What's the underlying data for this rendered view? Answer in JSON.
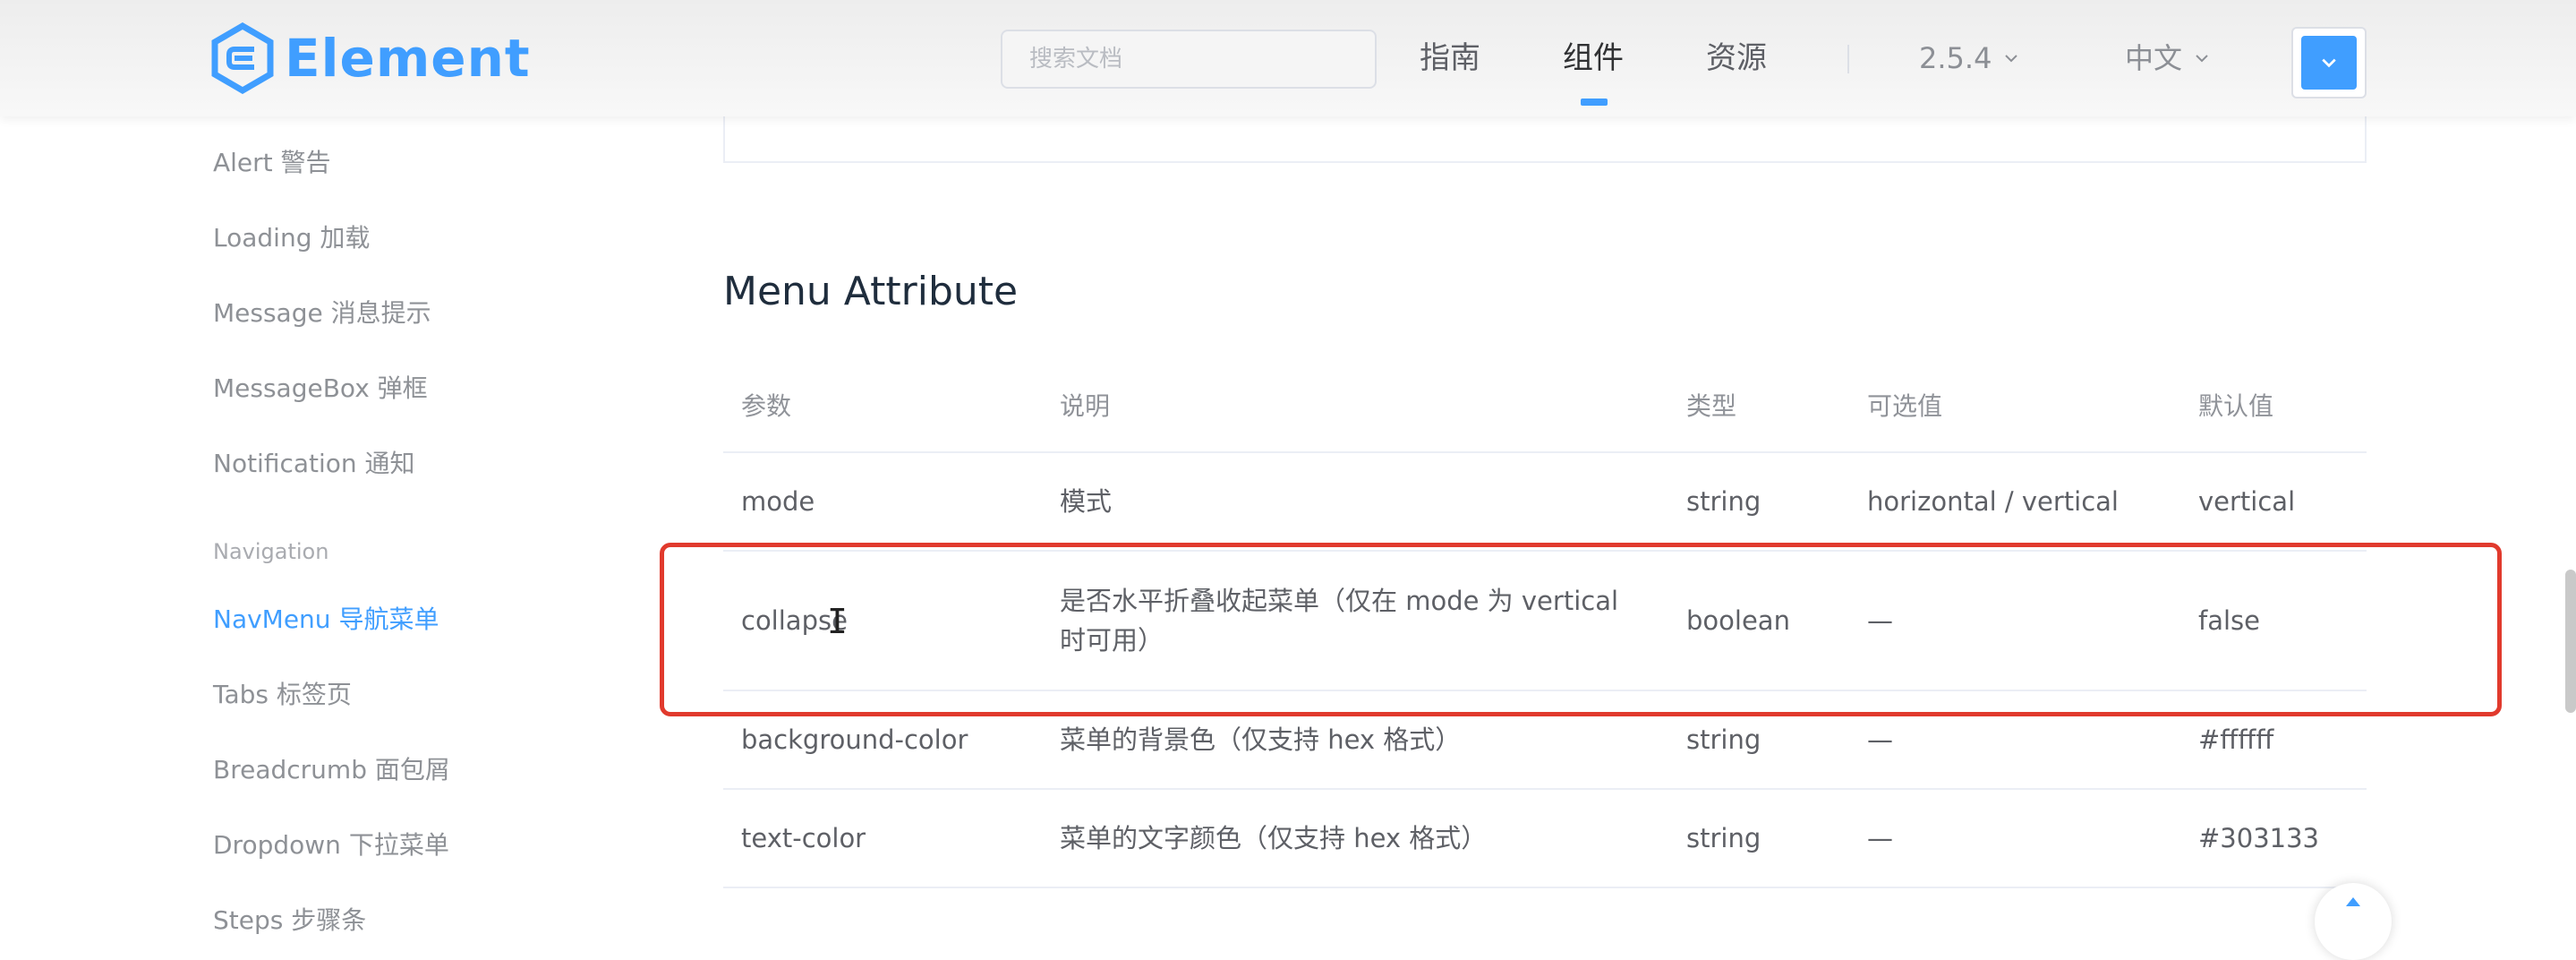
{
  "header": {
    "logo_text": "Element",
    "search_placeholder": "搜索文档",
    "nav": [
      "指南",
      "组件",
      "资源"
    ],
    "active_nav": "组件",
    "version": "2.5.4",
    "language": "中文",
    "accent_color": "#409eff"
  },
  "sidebar": {
    "items_top": [
      "Alert 警告",
      "Loading 加载",
      "Message 消息提示",
      "MessageBox 弹框",
      "Notification 通知"
    ],
    "group_label": "Navigation",
    "items_nav": [
      "NavMenu 导航菜单",
      "Tabs 标签页",
      "Breadcrumb 面包屑",
      "Dropdown 下拉菜单",
      "Steps 步骤条"
    ],
    "active_item": "NavMenu 导航菜单"
  },
  "main": {
    "section_title": "Menu Attribute",
    "table": {
      "headers": [
        "参数",
        "说明",
        "类型",
        "可选值",
        "默认值"
      ],
      "rows": [
        [
          "mode",
          "模式",
          "string",
          "horizontal / vertical",
          "vertical"
        ],
        [
          "collapse",
          "是否水平折叠收起菜单（仅在 mode 为 vertical 时可用）",
          "boolean",
          "—",
          "false"
        ],
        [
          "background-color",
          "菜单的背景色（仅支持 hex 格式）",
          "string",
          "—",
          "#ffffff"
        ],
        [
          "text-color",
          "菜单的文字颜色（仅支持 hex 格式）",
          "string",
          "—",
          "#303133"
        ]
      ],
      "highlighted_row": "collapse",
      "highlight_color": "#e13a2d"
    }
  },
  "icons": {
    "logo": "element-logo-icon",
    "chevron": "chevron-down-icon",
    "cursor": "text-cursor-icon",
    "back_to_top": "caret-up-icon"
  }
}
